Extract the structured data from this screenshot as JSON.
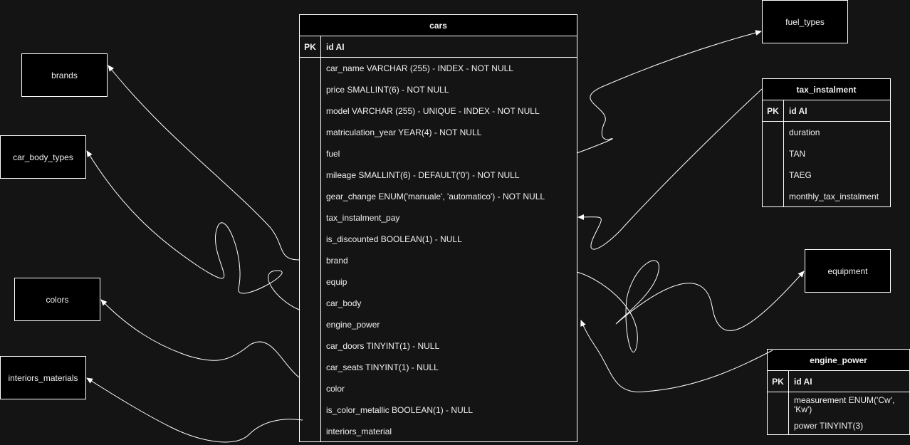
{
  "tables": {
    "cars": {
      "title": "cars",
      "pk_label": "PK",
      "pk_field": "id AI",
      "fields": [
        "car_name VARCHAR (255) - INDEX  - NOT NULL",
        "price SMALLINT(6) - NOT NULL",
        "model VARCHAR (255) - UNIQUE - INDEX - NOT NULL",
        "matriculation_year YEAR(4) - NOT NULL",
        "fuel",
        "mileage SMALLINT(6) - DEFAULT('0') - NOT NULL",
        "gear_change ENUM('manuale', 'automatico') - NOT NULL",
        "tax_instalment_pay",
        "is_discounted BOOLEAN(1) - NULL",
        "brand",
        "equip",
        "car_body",
        "engine_power",
        "car_doors TINYINT(1) - NULL",
        "car_seats TINYINT(1) - NULL",
        "color",
        "is_color_metallic BOOLEAN(1) - NULL",
        "interiors_material"
      ]
    },
    "tax_instalment": {
      "title": "tax_instalment",
      "pk_label": "PK",
      "pk_field": "id AI",
      "fields": [
        "duration",
        "TAN",
        "TAEG",
        "monthly_tax_instalment"
      ]
    },
    "engine_power": {
      "title": "engine_power",
      "pk_label": "PK",
      "pk_field": "id AI",
      "fields": [
        "measurement ENUM('Cw', 'Kw')",
        "power TINYINT(3)"
      ]
    }
  },
  "entities": {
    "brands": "brands",
    "car_body_types": "car_body_types",
    "colors": "colors",
    "interiors_materials": "interiors_materials",
    "fuel_types": "fuel_types",
    "equipment": "equipment"
  },
  "colors": {
    "background": "#141414",
    "box_fill": "#000000",
    "stroke": "#ffffff",
    "text": "#f0f0f0"
  }
}
